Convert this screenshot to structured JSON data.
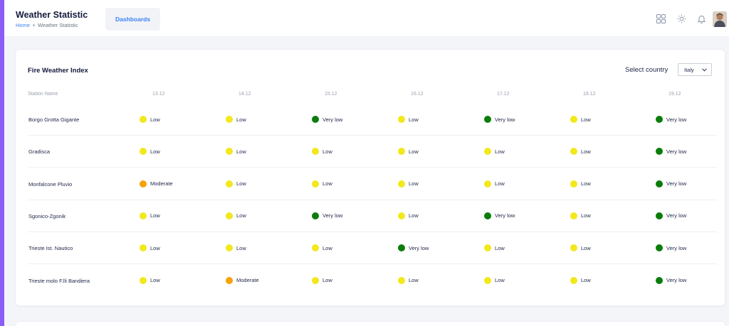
{
  "header": {
    "title": "Weather Statistic",
    "breadcrumb": [
      "Home",
      "Weather Statistic"
    ],
    "dashboards_label": "Dashboards"
  },
  "icons": [
    "grid-icon",
    "sun-icon",
    "bell-icon",
    "avatar"
  ],
  "card": {
    "title": "Fire Weather Index",
    "select_label": "Select country",
    "selected_country": "Italy"
  },
  "table": {
    "columns": [
      "Station Name",
      "13.12",
      "14.12",
      "15.12",
      "16.12",
      "17.12",
      "18.12",
      "19.12"
    ],
    "rows": [
      {
        "station": "Borgo Grotta Gigante",
        "values": [
          "Low",
          "Low",
          "Very low",
          "Low",
          "Very low",
          "Low",
          "Very low"
        ]
      },
      {
        "station": "Gradisca",
        "values": [
          "Low",
          "Low",
          "Low",
          "Low",
          "Low",
          "Low",
          "Very low"
        ]
      },
      {
        "station": "Monfalcone Pluvio",
        "values": [
          "Moderate",
          "Low",
          "Low",
          "Low",
          "Low",
          "Low",
          "Very low"
        ]
      },
      {
        "station": "Sgonico-Zgonik",
        "values": [
          "Low",
          "Low",
          "Very low",
          "Low",
          "Very low",
          "Low",
          "Very low"
        ]
      },
      {
        "station": "Trieste Ist. Nautico",
        "values": [
          "Low",
          "Low",
          "Low",
          "Very low",
          "Low",
          "Low",
          "Very low"
        ]
      },
      {
        "station": "Trieste molo F.lli Bandiera",
        "values": [
          "Low",
          "Moderate",
          "Low",
          "Low",
          "Low",
          "Low",
          "Very low"
        ]
      }
    ]
  },
  "level_colors": {
    "Very low": "#0a7d0a",
    "Low": "#f2e81c",
    "Moderate": "#f5a300"
  },
  "accent_color": "#8b5cf6"
}
